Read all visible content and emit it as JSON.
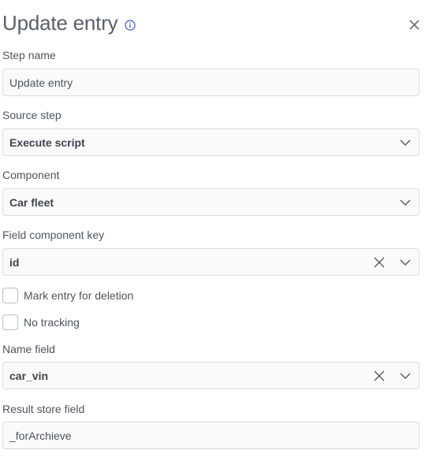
{
  "panel": {
    "title": "Update entry",
    "info_icon": "info-circle-icon",
    "close_icon": "close-icon",
    "accent_color": "#3d4fd1"
  },
  "step_name": {
    "label": "Step name",
    "value": "Update entry"
  },
  "source_step": {
    "label": "Source step",
    "value": "Execute script"
  },
  "component": {
    "label": "Component",
    "value": "Car fleet"
  },
  "field_component_key": {
    "label": "Field component key",
    "value": "id"
  },
  "mark_for_deletion": {
    "label": "Mark entry for deletion",
    "checked": false
  },
  "no_tracking": {
    "label": "No tracking",
    "checked": false
  },
  "name_field": {
    "label": "Name field",
    "value": "car_vin"
  },
  "result_store_field": {
    "label": "Result store field",
    "value": "_forArchieve"
  }
}
